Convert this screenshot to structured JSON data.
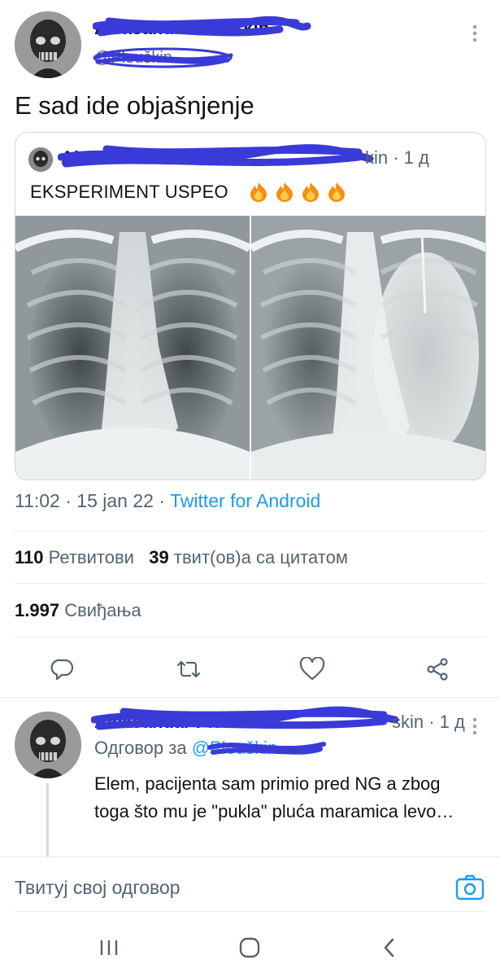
{
  "tweet": {
    "author_name": "Aleksandar Pleuškin",
    "author_handle": "@Pleuškin",
    "text": "E sad ide objašnjenje",
    "timestamp": "11:02 · 15 jan 22",
    "separator": " · ",
    "source": "Twitter for Android",
    "retweets_count": "110",
    "retweets_label": "Ретвитови",
    "quotes_count": "39",
    "quotes_label": "твит(ов)а са цитатом",
    "likes_count": "1.997",
    "likes_label": "Свиђања"
  },
  "quoted_tweet": {
    "author_name": "Aleksandar Pleuškin",
    "meta": "kin · 1 д",
    "text": "EKSPERIMENT USPEO",
    "fire_count": 4,
    "images": [
      "chest-xray-before",
      "chest-xray-after"
    ]
  },
  "actions": {
    "reply": "reply-icon",
    "retweet": "retweet-icon",
    "like": "heart-icon",
    "share": "share-icon"
  },
  "reply": {
    "meta": "skin · 1 д",
    "reply_to_label": "Одговор за",
    "reply_to_handle": "@Pleuškin",
    "text": "Elem, pacijenta sam primio pred NG a zbog toga što mu je \"pukla\" pluća maramica levo…"
  },
  "compose": {
    "placeholder": "Твитуј свој одговор"
  },
  "colors": {
    "link": "#1d9bf0",
    "secondary_text": "#536471",
    "divider": "#e6ecf0",
    "scribble": "#3a3ad8"
  }
}
